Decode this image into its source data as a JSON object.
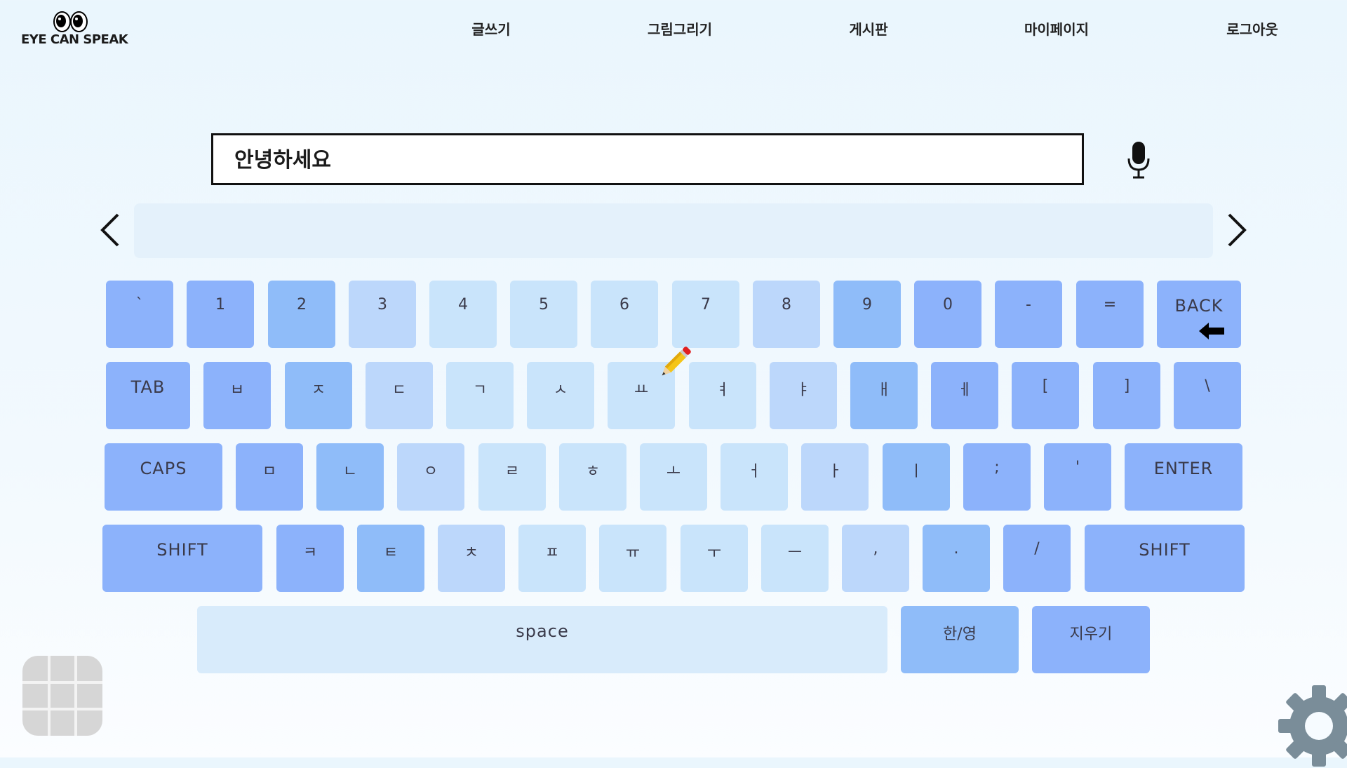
{
  "logo": {
    "text": "EYE CAN SPEAK"
  },
  "nav": [
    {
      "label": "글쓰기"
    },
    {
      "label": "그림그리기"
    },
    {
      "label": "게시판"
    },
    {
      "label": "마이페이지"
    },
    {
      "label": "로그아웃"
    }
  ],
  "editor": {
    "value": "안녕하세요"
  },
  "keyboard": {
    "row1": [
      "`",
      "1",
      "2",
      "3",
      "4",
      "5",
      "6",
      "7",
      "8",
      "9",
      "0",
      "-",
      "=",
      "BACK"
    ],
    "row2": [
      "TAB",
      "ㅂ",
      "ㅈ",
      "ㄷ",
      "ㄱ",
      "ㅅ",
      "ㅛ",
      "ㅕ",
      "ㅑ",
      "ㅐ",
      "ㅔ",
      "[",
      "]",
      "\\"
    ],
    "row3": [
      "CAPS",
      "ㅁ",
      "ㄴ",
      "ㅇ",
      "ㄹ",
      "ㅎ",
      "ㅗ",
      "ㅓ",
      "ㅏ",
      "ㅣ",
      ";",
      "'",
      "ENTER"
    ],
    "row4": [
      "SHIFT",
      "ㅋ",
      "ㅌ",
      "ㅊ",
      "ㅍ",
      "ㅠ",
      "ㅜ",
      "ㅡ",
      ",",
      ".",
      "/",
      "SHIFT"
    ],
    "row5": [
      "space",
      "한/영",
      "지우기"
    ]
  },
  "icons": {
    "mic": "microphone-icon",
    "prev": "chevron-left-icon",
    "next": "chevron-right-icon",
    "back": "arrow-left-icon",
    "grid": "grid-icon",
    "settings": "gear-icon",
    "cursor": "pencil-icon"
  }
}
